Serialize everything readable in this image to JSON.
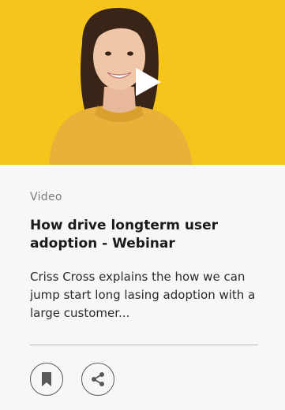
{
  "card": {
    "category": "Video",
    "title": "How drive longterm user adoption - Webinar",
    "description": "Criss Cross explains the how we can jump start long lasing adoption with a large customer...",
    "media": {
      "background_color": "#f5c51b",
      "overlay_icon": "play-icon"
    },
    "actions": [
      {
        "icon": "bookmark-icon"
      },
      {
        "icon": "share-icon"
      }
    ]
  },
  "colors": {
    "media_background": "#f5c51b",
    "card_background": "#f7f7f7",
    "title_text": "#1a1a1a",
    "category_text": "#7a7a7a",
    "icon_stroke": "#595959"
  }
}
